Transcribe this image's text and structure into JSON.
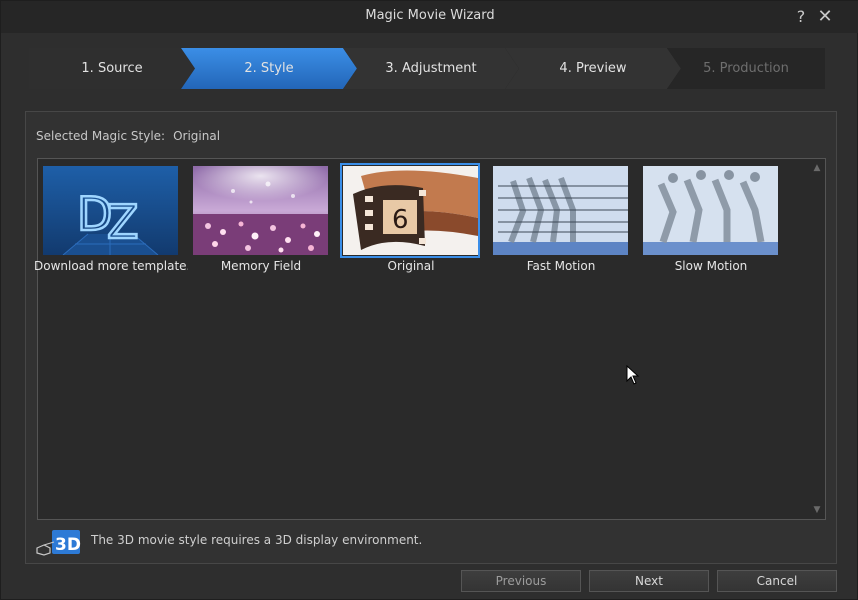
{
  "window": {
    "title": "Magic Movie Wizard",
    "help_glyph": "?",
    "close_glyph": "✕"
  },
  "steps": [
    {
      "label": "1. Source",
      "state": "done"
    },
    {
      "label": "2. Style",
      "state": "active"
    },
    {
      "label": "3. Adjustment",
      "state": "pending"
    },
    {
      "label": "4. Preview",
      "state": "pending"
    },
    {
      "label": "5. Production",
      "state": "disabled"
    }
  ],
  "selected_style": {
    "label": "Selected Magic Style:",
    "value": "Original"
  },
  "templates": [
    {
      "label": "Download more template...",
      "icon": "dz-logo-icon"
    },
    {
      "label": "Memory Field"
    },
    {
      "label": "Original",
      "selected": true
    },
    {
      "label": "Fast Motion"
    },
    {
      "label": "Slow Motion"
    }
  ],
  "scroll": {
    "up": "▲",
    "down": "▼"
  },
  "note": {
    "icon": "3d-glasses-icon",
    "badge": "3D",
    "text": "The 3D movie style requires a 3D display environment."
  },
  "buttons": {
    "previous": "Previous",
    "next": "Next",
    "cancel": "Cancel"
  },
  "colors": {
    "accent": "#2f7fd8",
    "selection_border": "#3a8ee8"
  }
}
